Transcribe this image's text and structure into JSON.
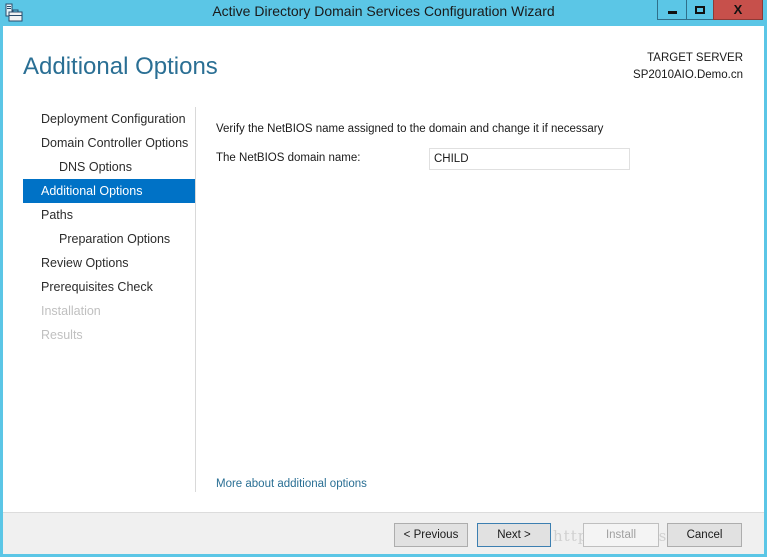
{
  "window": {
    "title": "Active Directory Domain Services Configuration Wizard",
    "app_icon": "server-toolbox-icon",
    "controls": {
      "minimize": "minimize-icon",
      "maximize": "maximize-icon",
      "close": "close-icon",
      "close_glyph": "X"
    }
  },
  "header": {
    "page_title": "Additional Options",
    "target_server_label": "TARGET SERVER",
    "target_server_name": "SP2010AIO.Demo.cn"
  },
  "nav": {
    "items": [
      {
        "label": "Deployment Configuration",
        "state": "normal",
        "level": 0
      },
      {
        "label": "Domain Controller Options",
        "state": "normal",
        "level": 0
      },
      {
        "label": "DNS Options",
        "state": "normal",
        "level": 1
      },
      {
        "label": "Additional Options",
        "state": "active",
        "level": 0
      },
      {
        "label": "Paths",
        "state": "normal",
        "level": 0
      },
      {
        "label": "Preparation Options",
        "state": "normal",
        "level": 1
      },
      {
        "label": "Review Options",
        "state": "normal",
        "level": 0
      },
      {
        "label": "Prerequisites Check",
        "state": "normal",
        "level": 0
      },
      {
        "label": "Installation",
        "state": "disabled",
        "level": 0
      },
      {
        "label": "Results",
        "state": "disabled",
        "level": 0
      }
    ]
  },
  "content": {
    "instruction": "Verify the NetBIOS name assigned to the domain and change it if necessary",
    "netbios_label": "The NetBIOS domain name:",
    "netbios_value": "CHILD",
    "more_link": "More about additional options"
  },
  "footer": {
    "previous": "< Previous",
    "next": "Next >",
    "install": "Install",
    "cancel": "Cancel",
    "watermark": "http://blog.csdn.net/"
  },
  "colors": {
    "titlebar": "#5bc6e6",
    "accent": "#0072c6",
    "title_text": "#2a6f94",
    "close_button": "#c7504b"
  }
}
